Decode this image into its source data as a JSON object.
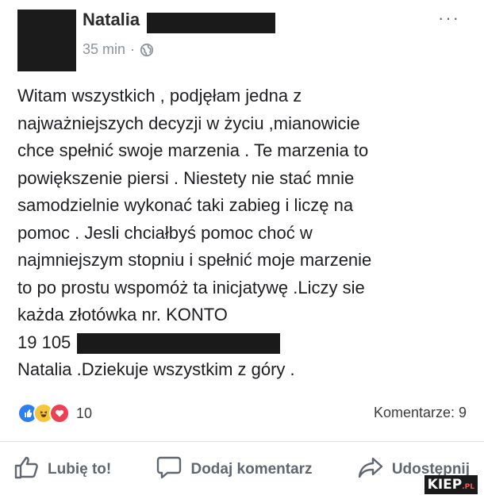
{
  "post": {
    "author_name": "Natalia",
    "time": "35 min",
    "separator": "·",
    "more_label": "···",
    "text_lines": [
      "Witam wszystkich , podjęłam jedna z",
      "najważniejszych decyzji w życiu ,mianowicie",
      "chce spełnić swoje marzenia . Te marzenia to",
      "powiększenie piersi . Niestety nie stać mnie",
      "samodzielnie wykonać taki zabieg i liczę na",
      "pomoc . Jesli chciałbyś pomoc choć w",
      "najmniejszym stopniu i spełnić moje marzenie",
      "to po prostu wspomóż ta inicjatywę .Liczy sie",
      "każda złotówka nr. KONTO"
    ],
    "account_prefix": "19 105",
    "closing_line": "Natalia .Dziekuje wszystkim z góry ."
  },
  "reactions": {
    "count": "10",
    "comments_label": "Komentarze: 9",
    "colors": {
      "like": "#2d7ef0",
      "haha": "#f7c43b",
      "love": "#ee3f55"
    }
  },
  "actions": {
    "like_label": "Lubię to!",
    "comment_label": "Dodaj komentarz",
    "share_label": "Udostępnij"
  },
  "watermark": {
    "main": "KIEP",
    "suffix": ".PL"
  }
}
